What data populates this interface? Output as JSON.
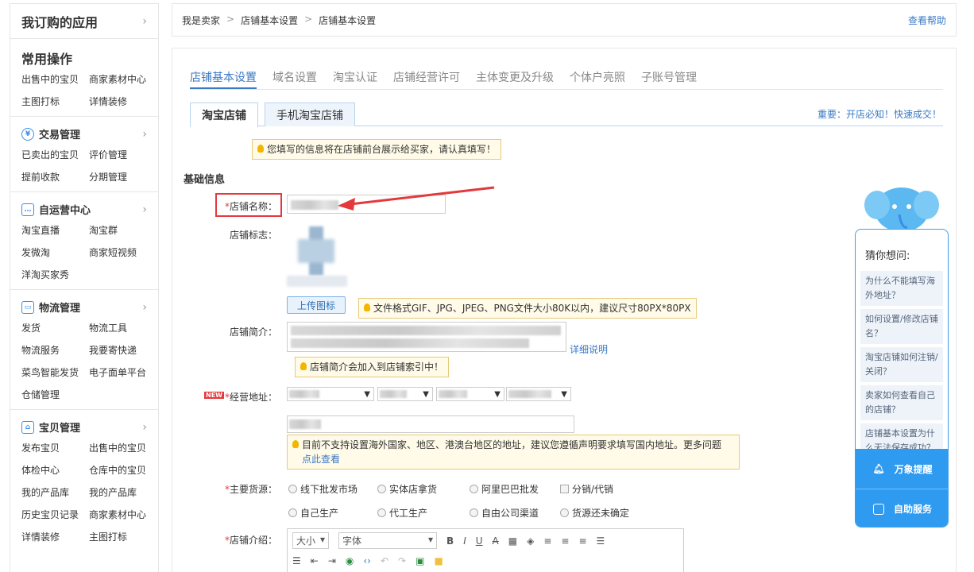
{
  "sidebar": {
    "header": "我订购的应用",
    "common_title": "常用操作",
    "common_items": [
      "出售中的宝贝",
      "商家素材中心",
      "主图打标",
      "详情装修"
    ],
    "categories": [
      {
        "icon": "yen-icon",
        "label": "交易管理",
        "items": [
          "已卖出的宝贝",
          "评价管理",
          "提前收款",
          "分期管理"
        ]
      },
      {
        "icon": "chat-icon",
        "label": "自运营中心",
        "items": [
          "淘宝直播",
          "淘宝群",
          "发微淘",
          "商家短视频",
          "洋淘买家秀"
        ]
      },
      {
        "icon": "truck-icon",
        "label": "物流管理",
        "items": [
          "发货",
          "物流工具",
          "物流服务",
          "我要寄快递",
          "菜鸟智能发货",
          "电子面单平台",
          "仓储管理"
        ]
      },
      {
        "icon": "bag-icon",
        "label": "宝贝管理",
        "items": [
          "发布宝贝",
          "出售中的宝贝",
          "体检中心",
          "仓库中的宝贝",
          "我的产品库",
          "我的产品库",
          "历史宝贝记录",
          "商家素材中心",
          "详情装修",
          "主图打标"
        ]
      }
    ]
  },
  "breadcrumb": [
    "我是卖家",
    "店铺基本设置",
    "店铺基本设置"
  ],
  "help_link": "查看帮助",
  "tabs": [
    "店铺基本设置",
    "域名设置",
    "淘宝认证",
    "店铺经营许可",
    "主体变更及升级",
    "个体户亮照",
    "子账号管理"
  ],
  "subtabs": [
    "淘宝店铺",
    "手机淘宝店铺"
  ],
  "important": "重要：开店必知！快速成交！",
  "top_tip": "您填写的信息将在店铺前台展示给买家，请认真填写！",
  "section_title": "基础信息",
  "form": {
    "shop_name_label": "店铺名称：",
    "logo_label": "店铺标志：",
    "upload_button": "上传图标",
    "logo_tip": "文件格式GIF、JPG、JPEG、PNG文件大小80K以内，建议尺寸80PX*80PX",
    "intro_label": "店铺简介：",
    "detail_link": "详细说明",
    "intro_tip": "店铺简介会加入到店铺索引中！",
    "new_badge": "NEW",
    "address_label": "经营地址：",
    "address_tip": "目前不支持设置海外国家、地区、港澳台地区的地址，建议您遵循声明要求填写国内地址。更多问题",
    "address_tip_link": "点此查看",
    "source_label": "主要货源：",
    "sources": [
      "线下批发市场",
      "实体店拿货",
      "阿里巴巴批发",
      "分销/代销",
      "自己生产",
      "代工生产",
      "自由公司渠道",
      "货源还未确定"
    ],
    "desc_label": "店铺介绍：",
    "editor_size": "大小",
    "editor_font": "字体"
  },
  "assistant": {
    "title": "猜你想问:",
    "questions": [
      "为什么不能填写海外地址？",
      "如何设置/修改店铺名？",
      "淘宝店铺如何注销/关闭？",
      "卖家如何查看自己的店铺？",
      "店铺基本设置为什么无法保存成功？"
    ],
    "remind_button": "万象提醒",
    "service_button": "自助服务"
  },
  "colors": {
    "accent": "#3a79c6",
    "required": "#e4393c",
    "highlight_box": "#e4393c",
    "assistant_blue": "#2e9af0"
  }
}
